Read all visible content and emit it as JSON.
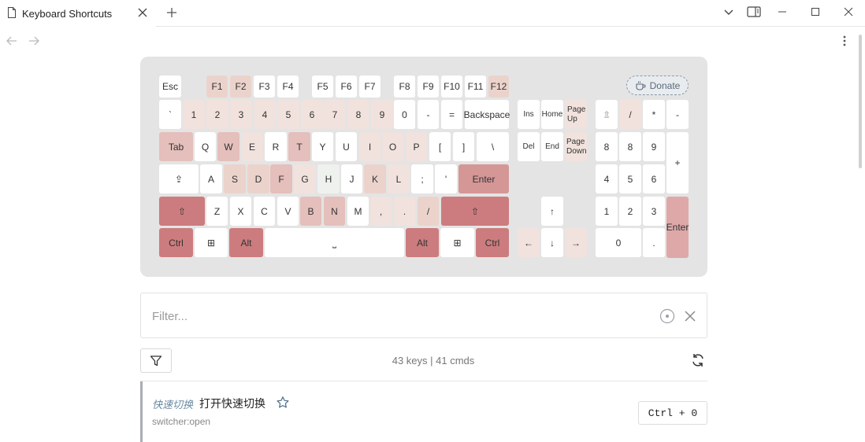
{
  "window": {
    "tab_title": "Keyboard Shortcuts",
    "icons": {
      "doc": "document-icon",
      "close": "close-icon",
      "new_tab": "plus-icon",
      "dropdown": "chevron-down-icon",
      "sidebar": "sidebar-toggle-icon",
      "minimize": "minimize-icon",
      "maximize": "maximize-icon",
      "close_window": "close-window-icon",
      "back": "arrow-left-icon",
      "forward": "arrow-right-icon",
      "more": "more-vertical-icon"
    }
  },
  "keyboard": {
    "donate_label": "Donate",
    "keys": [
      {
        "id": "esc",
        "label": "Esc"
      },
      {
        "id": "f1",
        "label": "F1"
      },
      {
        "id": "f2",
        "label": "F2"
      },
      {
        "id": "f3",
        "label": "F3"
      },
      {
        "id": "f4",
        "label": "F4"
      },
      {
        "id": "f5",
        "label": "F5"
      },
      {
        "id": "f6",
        "label": "F6"
      },
      {
        "id": "f7",
        "label": "F7"
      },
      {
        "id": "f8",
        "label": "F8"
      },
      {
        "id": "f9",
        "label": "F9"
      },
      {
        "id": "f10",
        "label": "F10"
      },
      {
        "id": "f11",
        "label": "F11"
      },
      {
        "id": "f12",
        "label": "F12"
      },
      {
        "id": "backtick",
        "label": "`"
      },
      {
        "id": "d1",
        "label": "1"
      },
      {
        "id": "d2",
        "label": "2"
      },
      {
        "id": "d3",
        "label": "3"
      },
      {
        "id": "d4",
        "label": "4"
      },
      {
        "id": "d5",
        "label": "5"
      },
      {
        "id": "d6",
        "label": "6"
      },
      {
        "id": "d7",
        "label": "7"
      },
      {
        "id": "d8",
        "label": "8"
      },
      {
        "id": "d9",
        "label": "9"
      },
      {
        "id": "d0",
        "label": "0"
      },
      {
        "id": "minus",
        "label": "-"
      },
      {
        "id": "equal",
        "label": "="
      },
      {
        "id": "backspace",
        "label": "Backspace"
      },
      {
        "id": "tab",
        "label": "Tab"
      },
      {
        "id": "q",
        "label": "Q"
      },
      {
        "id": "w",
        "label": "W"
      },
      {
        "id": "e",
        "label": "E"
      },
      {
        "id": "r",
        "label": "R"
      },
      {
        "id": "t",
        "label": "T"
      },
      {
        "id": "y",
        "label": "Y"
      },
      {
        "id": "u",
        "label": "U"
      },
      {
        "id": "i",
        "label": "I"
      },
      {
        "id": "o",
        "label": "O"
      },
      {
        "id": "p",
        "label": "P"
      },
      {
        "id": "lbracket",
        "label": "["
      },
      {
        "id": "rbracket",
        "label": "]"
      },
      {
        "id": "backslash",
        "label": "\\"
      },
      {
        "id": "capslock",
        "label": "⇪"
      },
      {
        "id": "a",
        "label": "A"
      },
      {
        "id": "s",
        "label": "S"
      },
      {
        "id": "d",
        "label": "D"
      },
      {
        "id": "f",
        "label": "F"
      },
      {
        "id": "g",
        "label": "G"
      },
      {
        "id": "h",
        "label": "H"
      },
      {
        "id": "j",
        "label": "J"
      },
      {
        "id": "k",
        "label": "K"
      },
      {
        "id": "l",
        "label": "L"
      },
      {
        "id": "semicolon",
        "label": ";"
      },
      {
        "id": "quote",
        "label": "'"
      },
      {
        "id": "enter",
        "label": "Enter"
      },
      {
        "id": "lshift",
        "label": "⇧"
      },
      {
        "id": "z",
        "label": "Z"
      },
      {
        "id": "x",
        "label": "X"
      },
      {
        "id": "c",
        "label": "C"
      },
      {
        "id": "v",
        "label": "V"
      },
      {
        "id": "b",
        "label": "B"
      },
      {
        "id": "n",
        "label": "N"
      },
      {
        "id": "m",
        "label": "M"
      },
      {
        "id": "comma",
        "label": ","
      },
      {
        "id": "period",
        "label": "."
      },
      {
        "id": "slash",
        "label": "/"
      },
      {
        "id": "rshift",
        "label": "⇧"
      },
      {
        "id": "lctrl",
        "label": "Ctrl"
      },
      {
        "id": "lwin",
        "label": "⊞"
      },
      {
        "id": "lalt",
        "label": "Alt"
      },
      {
        "id": "space",
        "label": "⎵"
      },
      {
        "id": "ralt",
        "label": "Alt"
      },
      {
        "id": "rwin",
        "label": "⊞"
      },
      {
        "id": "rctrl",
        "label": "Ctrl"
      },
      {
        "id": "ins",
        "label": "Ins"
      },
      {
        "id": "home",
        "label": "Home"
      },
      {
        "id": "pgup",
        "label": "Page Up"
      },
      {
        "id": "del",
        "label": "Del"
      },
      {
        "id": "end",
        "label": "End"
      },
      {
        "id": "pgdn",
        "label": "Page Down"
      },
      {
        "id": "up",
        "label": "↑"
      },
      {
        "id": "left",
        "label": "←"
      },
      {
        "id": "down",
        "label": "↓"
      },
      {
        "id": "right",
        "label": "→"
      },
      {
        "id": "numlock",
        "label": "⇭"
      },
      {
        "id": "numdiv",
        "label": "/"
      },
      {
        "id": "nummul",
        "label": "*"
      },
      {
        "id": "numsub",
        "label": "-"
      },
      {
        "id": "num7",
        "label": "8"
      },
      {
        "id": "num8",
        "label": "8"
      },
      {
        "id": "num9",
        "label": "9"
      },
      {
        "id": "numadd",
        "label": "+"
      },
      {
        "id": "num4",
        "label": "4"
      },
      {
        "id": "num5",
        "label": "5"
      },
      {
        "id": "num6",
        "label": "6"
      },
      {
        "id": "num1",
        "label": "1"
      },
      {
        "id": "num2",
        "label": "2"
      },
      {
        "id": "num3",
        "label": "3"
      },
      {
        "id": "numenter",
        "label": "Enter"
      },
      {
        "id": "num0",
        "label": "0"
      },
      {
        "id": "numdot",
        "label": "."
      }
    ]
  },
  "filter": {
    "placeholder": "Filter...",
    "icons": {
      "record": "record-icon",
      "clear": "close-icon"
    }
  },
  "toolbar": {
    "stats": "43 keys | 41 cmds",
    "icons": {
      "filter": "funnel-icon",
      "refresh": "refresh-icon"
    }
  },
  "commands": [
    {
      "category": "快速切换",
      "name": "打开快速切换",
      "id": "switcher:open",
      "hotkey": "Ctrl + 0"
    }
  ]
}
